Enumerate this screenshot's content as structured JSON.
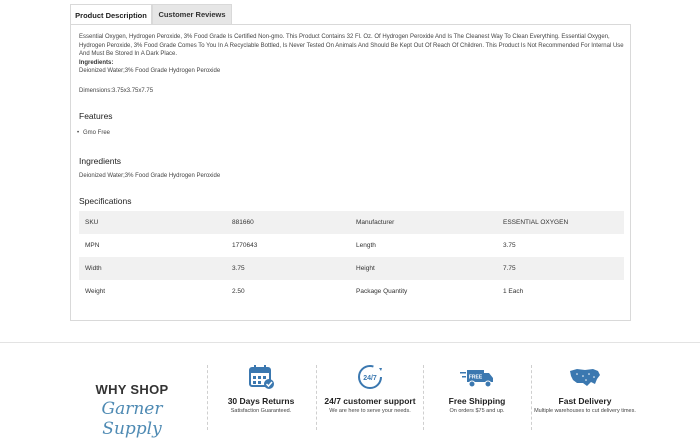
{
  "tabs": [
    {
      "label": "Product Description"
    },
    {
      "label": "Customer Reviews"
    }
  ],
  "description": {
    "text": "Essential Oxygen, Hydrogen Peroxide, 3% Food Grade Is Certified Non-gmo. This Product Contains 32 Fl. Oz. Of Hydrogen Peroxide And Is The Cleanest Way To Clean Everything. Essential Oxygen, Hydrogen Peroxide, 3% Food Grade Comes To You In A Recyclable Bottled, Is Never Tested On Animals And Should Be Kept Out Of Reach Of Children. This Product Is Not Recommended For Internal Use And Must Be Stored In A Dark Place.",
    "ingredients_label": "Ingredients:",
    "ingredients_text": "Deionized Water;3% Food Grade Hydrogen Peroxide",
    "dimensions": "Dimensions:3.75x3.75x7.75"
  },
  "features": {
    "title": "Features",
    "items": [
      "Gmo Free"
    ]
  },
  "ingredients": {
    "title": "Ingredients",
    "text": "Deionized Water;3% Food Grade Hydrogen Peroxide"
  },
  "specifications": {
    "title": "Specifications",
    "rows": [
      {
        "k1": "SKU",
        "v1": "881660",
        "k2": "Manufacturer",
        "v2": "ESSENTIAL OXYGEN"
      },
      {
        "k1": "MPN",
        "v1": "1770643",
        "k2": "Length",
        "v2": "3.75"
      },
      {
        "k1": "Width",
        "v1": "3.75",
        "k2": "Height",
        "v2": "7.75"
      },
      {
        "k1": "Weight",
        "v1": "2.50",
        "k2": "Package Quantity",
        "v2": "1 Each"
      }
    ]
  },
  "why": {
    "top": "WHY SHOP",
    "brand": "Garner Supply"
  },
  "perks": [
    {
      "icon": "calendar-icon",
      "title": "30 Days Returns",
      "sub": "Satisfaction Guaranteed."
    },
    {
      "icon": "support-24-7-icon",
      "title": "24/7 customer support",
      "sub": "We are here to serve your needs."
    },
    {
      "icon": "truck-icon",
      "title": "Free Shipping",
      "sub": "On orders $75 and up.",
      "badge": "FREE"
    },
    {
      "icon": "usa-map-icon",
      "title": "Fast Delivery",
      "sub": "Multiple warehouses to cut delivery times."
    }
  ],
  "colors": {
    "accent": "#3b78b0",
    "brand": "#4e8ab3"
  }
}
